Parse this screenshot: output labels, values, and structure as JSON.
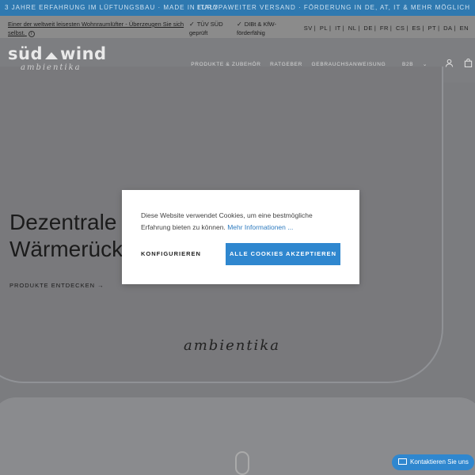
{
  "announcement": {
    "left": "3 Jahre Erfahrung im Lüftungsbau · Made in Italy",
    "right": "Europaweiter Versand · Förderung in DE, AT, IT & mehr möglich"
  },
  "info_bar": {
    "promo": "Einer der weltweit leisesten Wohnraumlüfter - Überzeugen Sie sich selbst.",
    "features": [
      "TÜV SÜD geprüft",
      "DIBt & KfW-förderfähig"
    ],
    "languages": [
      "SV",
      "PL",
      "IT",
      "NL",
      "DE",
      "FR",
      "CS",
      "ES",
      "PT",
      "DA",
      "EN"
    ]
  },
  "header": {
    "logo_left": "süd",
    "logo_right": "wind",
    "logo_sub": "ambientika",
    "nav": [
      "Produkte & Zubehör",
      "Ratgeber",
      "Gebrauchsanweisung",
      "B2B"
    ],
    "icons": [
      "account-icon",
      "cart-icon"
    ]
  },
  "hero": {
    "title_line1": "Dezentrale W",
    "title_line2": "Wärmerückg",
    "cta": "Produkte entdecken →",
    "device_script": "ambientika"
  },
  "cookie_modal": {
    "message": "Diese Website verwendet Cookies, um eine bestmögliche Erfahrung bieten zu können.",
    "more_link": "Mehr Informationen ...",
    "configure": "Konfigurieren",
    "accept_all": "Alle Cookies akzeptieren"
  },
  "contact": {
    "label": "Kontaktieren Sie uns"
  },
  "colors": {
    "accent": "#2f87cf",
    "announcement_bg": "#2f79b0"
  }
}
